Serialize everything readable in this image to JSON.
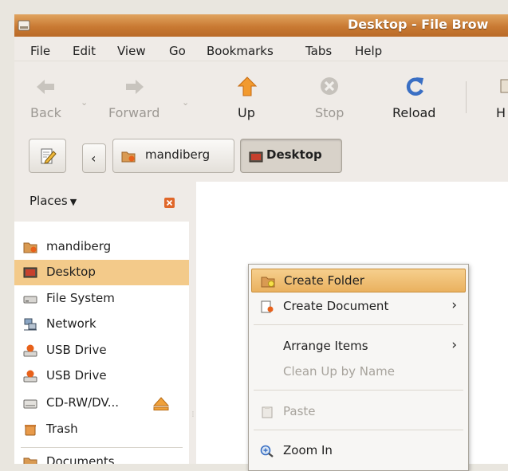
{
  "window": {
    "title": "Desktop - File Brow"
  },
  "menubar": {
    "items": [
      "File",
      "Edit",
      "View",
      "Go",
      "Bookmarks",
      "Tabs",
      "Help"
    ]
  },
  "toolbar": {
    "back": "Back",
    "forward": "Forward",
    "up": "Up",
    "stop": "Stop",
    "reload": "Reload",
    "home": "H"
  },
  "location": {
    "crumbs": [
      "mandiberg",
      "Desktop"
    ]
  },
  "sidebar": {
    "header": "Places",
    "items": [
      "mandiberg",
      "Desktop",
      "File System",
      "Network",
      "USB Drive",
      "USB Drive",
      "CD-RW/DV...",
      "Trash",
      "Documents"
    ]
  },
  "context_menu": {
    "items": [
      "Create Folder",
      "Create Document",
      "Arrange Items",
      "Clean Up by Name",
      "Paste",
      "Zoom In"
    ]
  },
  "colors": {
    "selection": "#f3ca8a",
    "titlebar": "#c97a33",
    "close_badge": "#e0672a"
  }
}
